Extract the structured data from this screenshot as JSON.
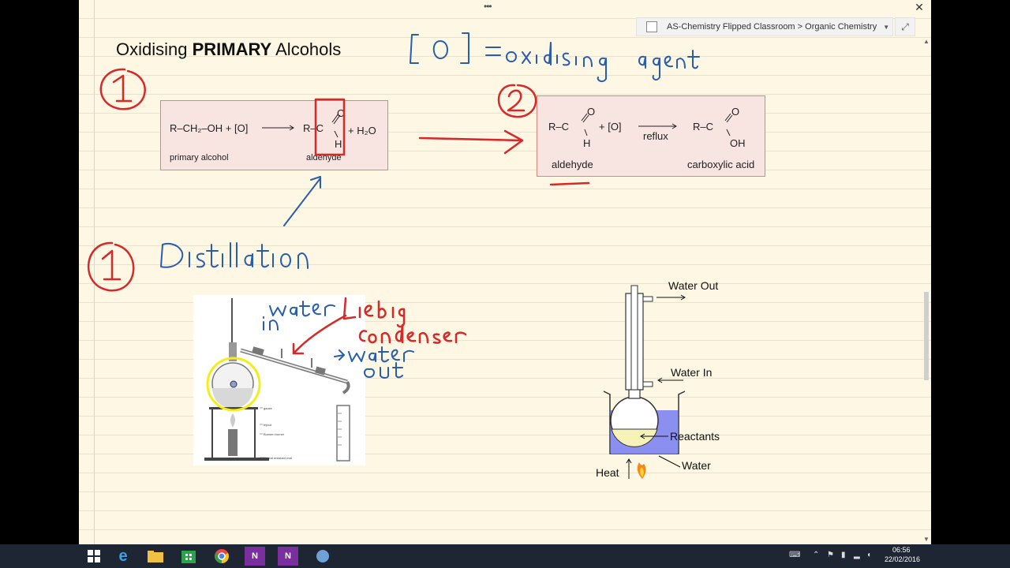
{
  "window": {
    "title_dots": "•••",
    "close_glyph": "✕",
    "breadcrumb": "AS-Chemistry Flipped Classroom > Organic Chemistry",
    "breadcrumb_dropdown": "▼",
    "expand_glyph": "⤢",
    "scroll_up": "▲",
    "scroll_down": "▼"
  },
  "note": {
    "title_prefix": "Oxidising ",
    "title_bold": "PRIMARY",
    "title_suffix": " Alcohols"
  },
  "equation1": {
    "reactant": "R–CH₂–OH + [O]",
    "product_r": "R–C",
    "o": "O",
    "h": "H",
    "plus_water": "+ H₂O",
    "reactant_label": "primary alcohol",
    "product_label": "aldehyde"
  },
  "equation2": {
    "reactant_r": "R–C",
    "o1": "O",
    "h": "H",
    "plus_o": "+ [O]",
    "condition": "reflux",
    "product_r": "R–C",
    "o2": "O",
    "oh": "OH",
    "reactant_label": "aldehyde",
    "product_label": "carboxylic acid"
  },
  "distillation_photo": {
    "labels": [
      "gauze",
      "tripod",
      "Bunsen burner",
      "heat resistant mat"
    ]
  },
  "reflux_diagram": {
    "water_out": "Water Out",
    "water_in": "Water In",
    "reactants": "Reactants",
    "water": "Water",
    "heat": "Heat"
  },
  "taskbar": {
    "clock_time": "06:56",
    "clock_date": "22/02/2016"
  },
  "colors": {
    "paper": "#fdf7e3",
    "red_ink": "#d62a2a",
    "blue_ink": "#2a5db0",
    "equation_box": "#f8e4e1"
  }
}
